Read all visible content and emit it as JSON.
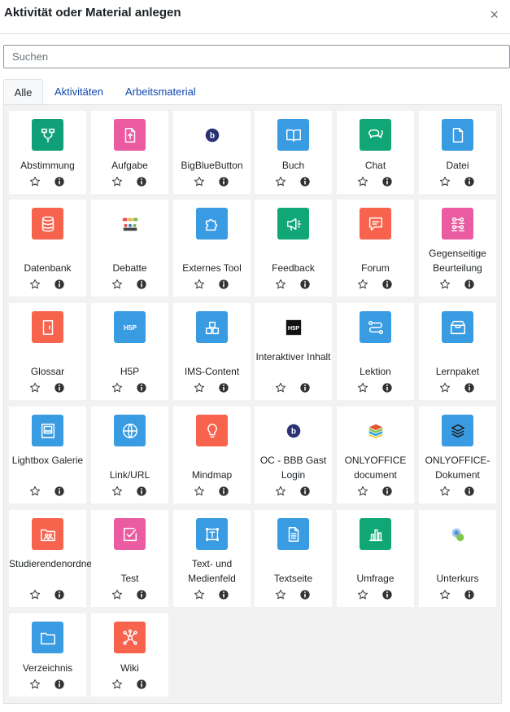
{
  "title": "Aktivität oder Material anlegen",
  "close_glyph": "×",
  "search": {
    "placeholder": "Suchen"
  },
  "tabs": [
    {
      "label": "Alle",
      "active": true
    },
    {
      "label": "Aktivitäten",
      "active": false
    },
    {
      "label": "Arbeitsmaterial",
      "active": false
    }
  ],
  "modules": [
    {
      "label": "Abstimmung",
      "icon": "choice-icon",
      "color": "#0fa07a"
    },
    {
      "label": "Aufgabe",
      "icon": "assignment-icon",
      "color": "#ea5ba1"
    },
    {
      "label": "BigBlueButton",
      "icon": "bigbluebutton-icon",
      "color": "#ffffff"
    },
    {
      "label": "Buch",
      "icon": "book-icon",
      "color": "#399be2"
    },
    {
      "label": "Chat",
      "icon": "chat-icon",
      "color": "#11a676"
    },
    {
      "label": "Datei",
      "icon": "file-icon",
      "color": "#399be2"
    },
    {
      "label": "Datenbank",
      "icon": "database-icon",
      "color": "#f7634d"
    },
    {
      "label": "Debatte",
      "icon": "debate-icon",
      "color": "#ffffff"
    },
    {
      "label": "Externes Tool",
      "icon": "external-tool-icon",
      "color": "#399be2"
    },
    {
      "label": "Feedback",
      "icon": "feedback-icon",
      "color": "#11a676"
    },
    {
      "label": "Forum",
      "icon": "forum-icon",
      "color": "#f7634d"
    },
    {
      "label": "Gegenseitige Beurteilung",
      "icon": "workshop-icon",
      "color": "#ea5ba1"
    },
    {
      "label": "Glossar",
      "icon": "glossary-icon",
      "color": "#f7634d"
    },
    {
      "label": "H5P",
      "icon": "h5p-icon",
      "color": "#399be2"
    },
    {
      "label": "IMS-Content",
      "icon": "ims-content-icon",
      "color": "#399be2"
    },
    {
      "label": "Interaktiver Inhalt",
      "icon": "interactive-content-icon",
      "color": "#ffffff"
    },
    {
      "label": "Lektion",
      "icon": "lesson-icon",
      "color": "#399be2"
    },
    {
      "label": "Lernpaket",
      "icon": "scorm-package-icon",
      "color": "#399be2"
    },
    {
      "label": "Lightbox Galerie",
      "icon": "lightbox-gallery-icon",
      "color": "#399be2"
    },
    {
      "label": "Link/URL",
      "icon": "globe-icon",
      "color": "#399be2"
    },
    {
      "label": "Mindmap",
      "icon": "lightbulb-icon",
      "color": "#f7634d"
    },
    {
      "label": "OC - BBB Gast Login",
      "icon": "bigbluebutton-icon",
      "color": "#ffffff"
    },
    {
      "label": "ONLYOFFICE document",
      "icon": "onlyoffice-icon",
      "color": "#ffffff"
    },
    {
      "label": "ONLYOFFICE-Dokument",
      "icon": "onlyoffice-layers-icon",
      "color": "#399be2"
    },
    {
      "label": "Studierendenordner",
      "icon": "student-folder-icon",
      "color": "#f7634d"
    },
    {
      "label": "Test",
      "icon": "quiz-icon",
      "color": "#ea5ba1"
    },
    {
      "label": "Text- und Medienfeld",
      "icon": "text-media-icon",
      "color": "#399be2"
    },
    {
      "label": "Textseite",
      "icon": "page-icon",
      "color": "#399be2"
    },
    {
      "label": "Umfrage",
      "icon": "bar-chart-icon",
      "color": "#11a676"
    },
    {
      "label": "Unterkurs",
      "icon": "subcourse-icon",
      "color": "#ffffff"
    },
    {
      "label": "Verzeichnis",
      "icon": "folder-icon",
      "color": "#399be2"
    },
    {
      "label": "Wiki",
      "icon": "wiki-icon",
      "color": "#f7634d"
    }
  ]
}
